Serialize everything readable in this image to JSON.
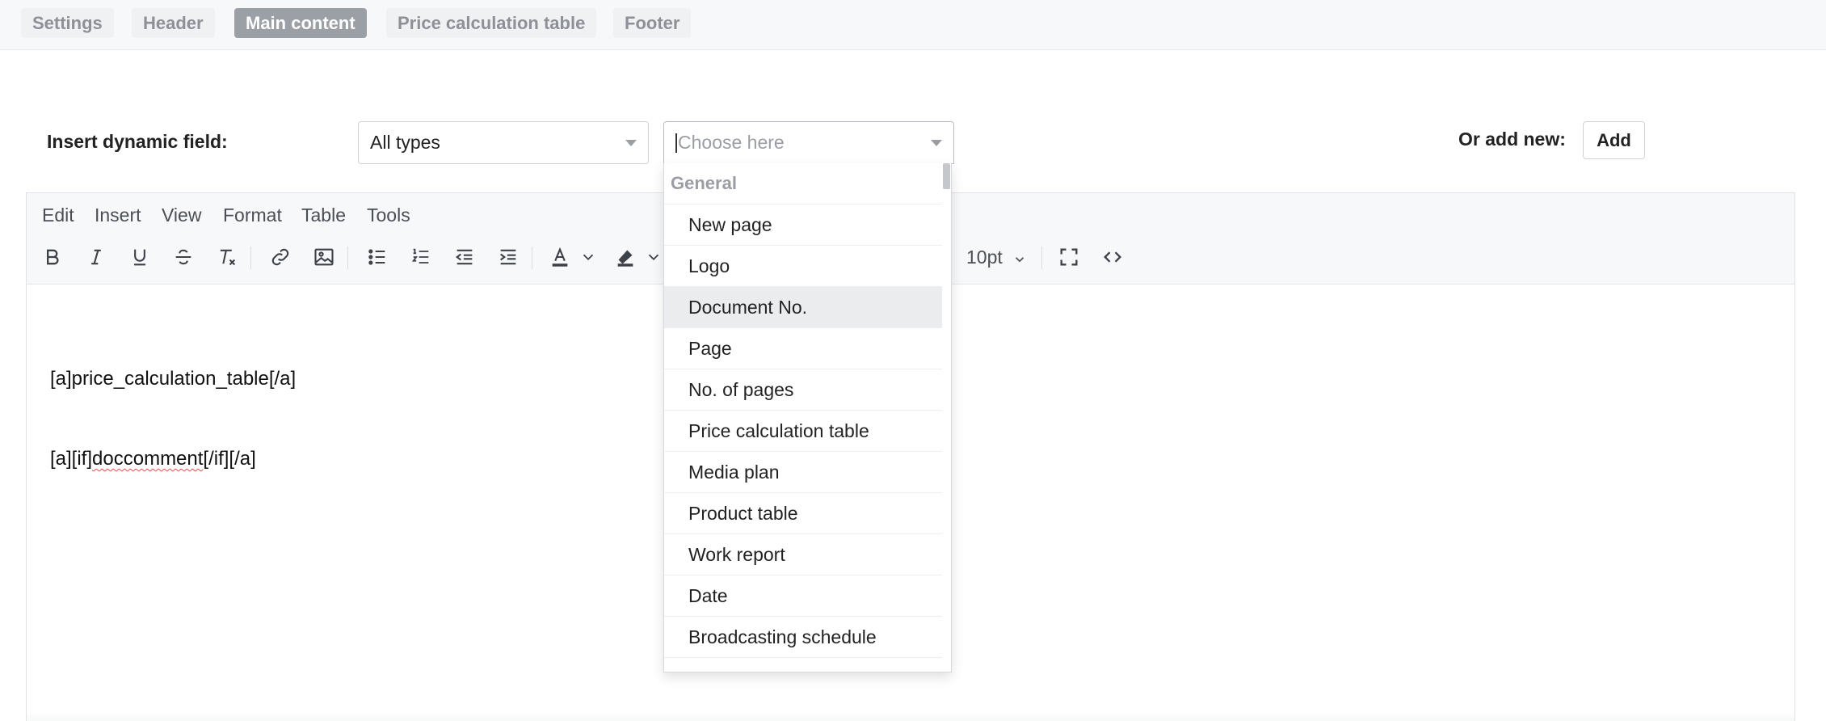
{
  "tabs": [
    {
      "label": "Settings",
      "active": false
    },
    {
      "label": "Header",
      "active": false
    },
    {
      "label": "Main content",
      "active": true
    },
    {
      "label": "Price calculation table",
      "active": false
    },
    {
      "label": "Footer",
      "active": false
    }
  ],
  "dynamic_field": {
    "label": "Insert dynamic field:",
    "type_select_value": "All types",
    "field_select_placeholder": "Choose here",
    "add_new_label": "Or add new:",
    "add_button": "Add"
  },
  "editor": {
    "menu": [
      "Edit",
      "Insert",
      "View",
      "Format",
      "Table",
      "Tools"
    ],
    "font_size": "10pt",
    "toolbar_icons": [
      "bold-icon",
      "italic-icon",
      "underline-icon",
      "strikethrough-icon",
      "clear-formatting-icon",
      "link-icon",
      "image-icon",
      "bullet-list-icon",
      "numbered-list-icon",
      "outdent-icon",
      "indent-icon",
      "text-color-icon",
      "highlight-color-icon",
      "fullscreen-icon",
      "source-code-icon"
    ],
    "content": {
      "line1": "[a]price_calculation_table[/a]",
      "line2_prefix": "[a][if]",
      "line2_misspelled": "doccomment",
      "line2_suffix": "[/if][/a]"
    }
  },
  "dropdown": {
    "group": "General",
    "options": [
      "New page",
      "Logo",
      "Document No.",
      "Page",
      "No. of pages",
      "Price calculation table",
      "Media plan",
      "Product table",
      "Work report",
      "Date",
      "Broadcasting schedule"
    ],
    "highlighted": "Document No."
  },
  "colors": {
    "active_tab_bg": "#9ba0a6",
    "toolbar_bg": "#f7f8fa",
    "highlight_row": "#ebecee",
    "spellcheck_underline": "#e05252"
  }
}
